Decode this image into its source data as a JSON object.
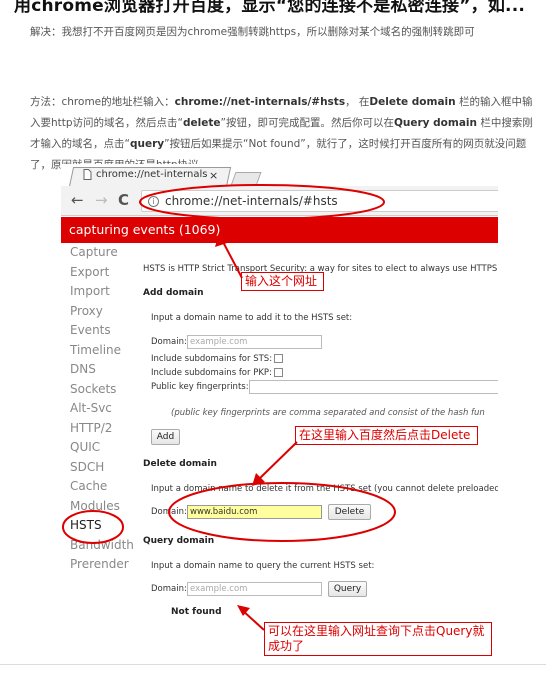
{
  "article": {
    "title": "用chrome浏览器打开百度，显示“您的连接不是私密连接”，如...",
    "solution": "解决：我想打不开百度网页是因为chrome强制转跳https，所以删除对某个域名的强制转跳即可",
    "method": {
      "p1": "方法：chrome的地址栏输入：",
      "url": "chrome://net-internals/#hsts",
      "p2": "， 在",
      "dd": "Delete domain",
      "p3": " 栏的输入框中输入要http访问的域名，然后点击“",
      "del": "delete",
      "p4": "”按钮，即可完成配置。然后你可以在",
      "qd": "Query domain",
      "p5": " 栏中搜索刚才输入的域名，点击“",
      "q": "query",
      "p6": "”按钮后如果提示“Not found”，就行了，这时候打开百度所有的网页就没问题了，原因就是百度用的还是http协议"
    }
  },
  "browser": {
    "tab_title": "chrome://net-internals",
    "tab_close": "×",
    "back": "←",
    "forward": "→",
    "reload": "C",
    "address": "chrome://net-internals/#hsts",
    "capture_bar": "capturing events (1069)"
  },
  "sidebar": {
    "items": [
      "Capture",
      "Export",
      "Import",
      "Proxy",
      "Events",
      "Timeline",
      "DNS",
      "Sockets",
      "Alt-Svc",
      "HTTP/2",
      "QUIC",
      "SDCH",
      "Cache",
      "Modules",
      "HSTS",
      "Bandwidth",
      "Prerender"
    ],
    "active": "HSTS"
  },
  "hsts": {
    "intro": "HSTS is HTTP Strict Transport Security: a way for sites to elect to always use HTTPS. S",
    "add_heading": "Add domain",
    "add_desc": "Input a domain name to add it to the HSTS set:",
    "domain_label": "Domain:",
    "domain_placeholder": "example.com",
    "sts_label": "Include subdomains for STS:",
    "pkp_label": "Include subdomains for PKP:",
    "fp_label": "Public key fingerprints:",
    "fp_note": "(public key fingerprints are comma separated and consist of the hash fun",
    "add_button": "Add",
    "delete_heading": "Delete domain",
    "delete_desc": "Input a domain name to delete it from the HSTS set (you cannot delete preloaded e",
    "delete_value": "www.baidu.com",
    "delete_button": "Delete",
    "query_heading": "Query domain",
    "query_desc": "Input a domain name to query the current HSTS set:",
    "query_button": "Query",
    "not_found": "Not found"
  },
  "annotations": {
    "a1": "输入这个网址",
    "a2": "在这里输入百度然后点击Delete",
    "a3": "可以在这里输入网址查询下点击Query就成功了"
  },
  "colors": {
    "red": "#dd0000",
    "annotation": "#dd0000",
    "highlight": "#ffff9e"
  }
}
